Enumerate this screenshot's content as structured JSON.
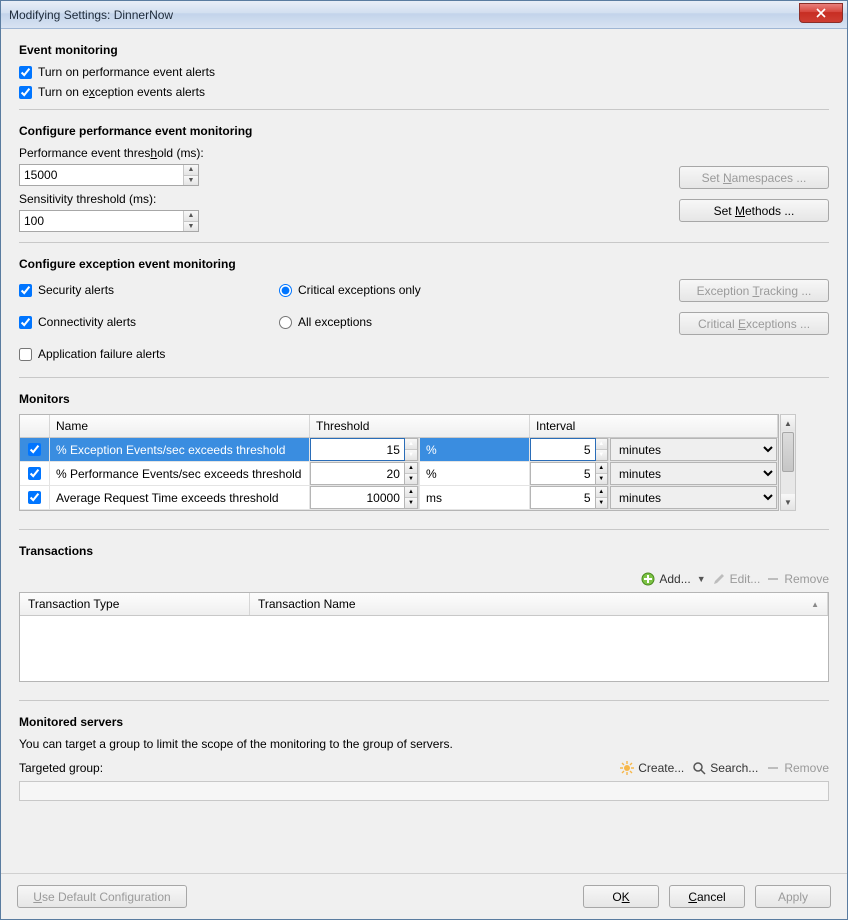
{
  "window": {
    "title": "Modifying Settings: DinnerNow"
  },
  "event_monitoring": {
    "heading": "Event monitoring",
    "perf_alerts_label": "Turn on performance event alerts",
    "perf_alerts_checked": true,
    "excp_alerts_label_pre": "Turn on e",
    "excp_alerts_label_und": "x",
    "excp_alerts_label_post": "ception events alerts",
    "excp_alerts_checked": true
  },
  "perf_config": {
    "heading": "Configure performance event monitoring",
    "threshold_label_pre": "Performance event thres",
    "threshold_label_und": "h",
    "threshold_label_post": "old (ms):",
    "threshold_value": "15000",
    "sensitivity_label": "Sensitivity threshold (ms):",
    "sensitivity_value": "100",
    "set_namespaces_pre": "Set ",
    "set_namespaces_und": "N",
    "set_namespaces_post": "amespaces ...",
    "set_methods_pre": "Set ",
    "set_methods_und": "M",
    "set_methods_post": "ethods ..."
  },
  "excp_config": {
    "heading": "Configure exception event monitoring",
    "security_label": "Security alerts",
    "security_checked": true,
    "connectivity_label": "Connectivity alerts",
    "connectivity_checked": true,
    "appfail_label": "Application failure alerts",
    "appfail_checked": false,
    "critical_only_label": "Critical exceptions only",
    "all_exceptions_label": "All exceptions",
    "radio_selected": "critical",
    "btn_tracking_pre": "Exception ",
    "btn_tracking_und": "T",
    "btn_tracking_post": "racking ...",
    "btn_critical_pre": "Critical ",
    "btn_critical_und": "E",
    "btn_critical_post": "xceptions ..."
  },
  "monitors": {
    "heading": "Monitors",
    "col_name": "Name",
    "col_threshold": "Threshold",
    "col_interval": "Interval",
    "rows": [
      {
        "checked": true,
        "name": "% Exception Events/sec exceeds threshold",
        "threshold": "15",
        "unit": "%",
        "interval": "5",
        "interval_unit": "minutes",
        "selected": true
      },
      {
        "checked": true,
        "name": "% Performance Events/sec exceeds threshold",
        "threshold": "20",
        "unit": "%",
        "interval": "5",
        "interval_unit": "minutes",
        "selected": false
      },
      {
        "checked": true,
        "name": "Average Request Time exceeds threshold",
        "threshold": "10000",
        "unit": "ms",
        "interval": "5",
        "interval_unit": "minutes",
        "selected": false
      }
    ]
  },
  "transactions": {
    "heading": "Transactions",
    "add_label": "Add...",
    "edit_label": "Edit...",
    "remove_label": "Remove",
    "col_type": "Transaction Type",
    "col_name": "Transaction Name"
  },
  "monitored_servers": {
    "heading": "Monitored servers",
    "desc": "You can target a group to limit the scope of the monitoring to the group of servers.",
    "targeted_label": "Targeted group:",
    "create_label": "Create...",
    "search_label": "Search...",
    "remove_label": "Remove"
  },
  "bottom": {
    "use_default_pre": "",
    "use_default_und": "U",
    "use_default_post": "se Default Configuration",
    "ok_pre": "O",
    "ok_und": "K",
    "ok_post": "",
    "cancel_pre": "",
    "cancel_und": "C",
    "cancel_post": "ancel",
    "apply_label": "Apply"
  }
}
